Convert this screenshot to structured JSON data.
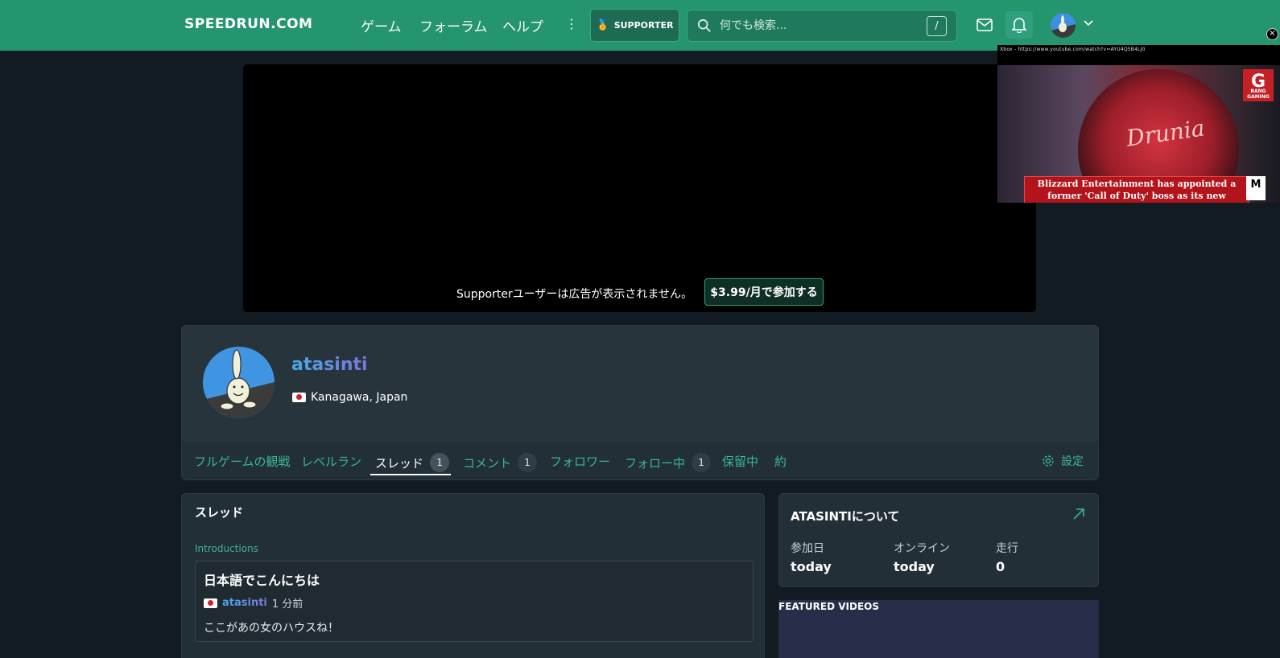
{
  "header": {
    "logo": "SPEEDRUN.COM",
    "nav": [
      "ゲーム",
      "フォーラム",
      "ヘルプ"
    ],
    "more": "⋮",
    "supporter_label": "SUPPORTER",
    "search_placeholder": "何でも検索...",
    "search_shortcut": "/"
  },
  "ad": {
    "message": "Supporterユーザーは広告が表示されません。",
    "cta": "$3.99/月で参加する"
  },
  "video_overlay": {
    "url_text": "Xbox - https://www.youtube.com/watch?v=AYU4Q5B4LJ0",
    "disc_text": "Drunia",
    "logo_text": "G",
    "logo_sub": "BANG GAMING",
    "headline": "Blizzard Entertainment has appointed a former 'Call of Duty' boss as its new president",
    "rating": "M",
    "close": "×"
  },
  "profile": {
    "username": "atasinti",
    "location": "Kanagawa, Japan",
    "tabs": [
      {
        "label": "フルゲームの観戦",
        "count": null
      },
      {
        "label": "レベルラン",
        "count": null
      },
      {
        "label": "スレッド",
        "count": "1"
      },
      {
        "label": "コメント",
        "count": "1"
      },
      {
        "label": "フォロワー",
        "count": null
      },
      {
        "label": "フォロー中",
        "count": "1"
      },
      {
        "label": "保留中",
        "count": null
      },
      {
        "label": "約",
        "count": null
      }
    ],
    "settings": "設定"
  },
  "threads": {
    "title": "スレッド",
    "forum": "Introductions",
    "thread_title": "日本語でこんにちは",
    "author": "atasinti",
    "time": "1 分前",
    "body": "ここがあの女のハウスね！"
  },
  "about": {
    "title": "ATASINTIについて",
    "stats": [
      {
        "label": "参加日",
        "value": "today"
      },
      {
        "label": "オンライン",
        "value": "today"
      },
      {
        "label": "走行",
        "value": "0"
      }
    ]
  },
  "featured": {
    "title": "FEATURED VIDEOS"
  }
}
